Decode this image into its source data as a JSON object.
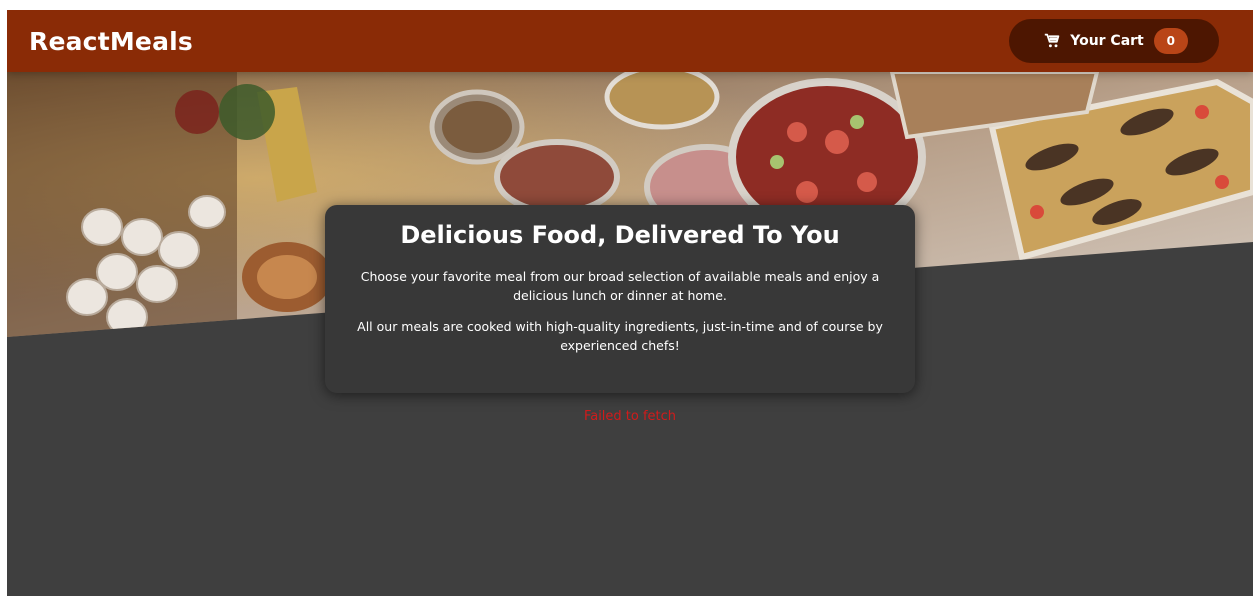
{
  "header": {
    "title": "ReactMeals",
    "cart": {
      "icon": "cart-icon",
      "label": "Your Cart",
      "count": "0"
    }
  },
  "hero": {
    "image": "meals-buffet-photo"
  },
  "summary": {
    "heading": "Delicious Food, Delivered To You",
    "paragraph1": "Choose your favorite meal from our broad selection of available meals and enjoy a delicious lunch or dinner at home.",
    "paragraph2": "All our meals are cooked with high-quality ingredients, just-in-time and of course by experienced chefs!"
  },
  "meals": {
    "error": "Failed to fetch"
  },
  "colors": {
    "header_bg": "#8a2b06",
    "cart_button_bg": "#4d1601",
    "cart_badge_bg": "#b94517",
    "page_bg": "#3f3f3f",
    "error": "#d11b1b"
  }
}
